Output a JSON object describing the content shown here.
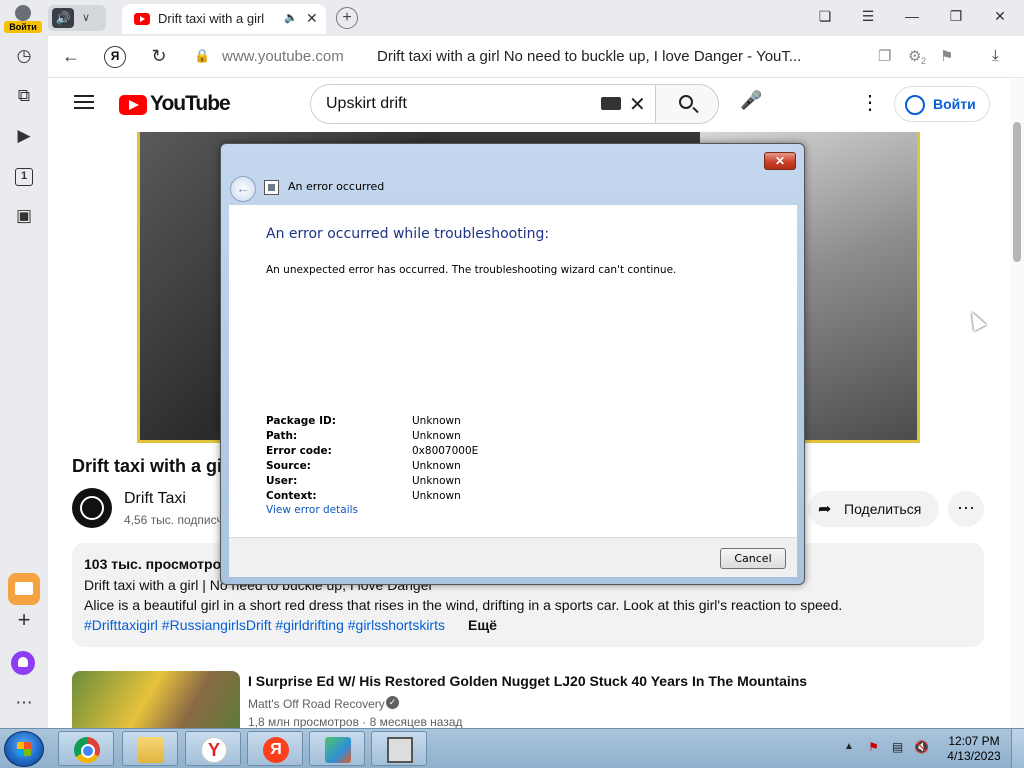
{
  "browser": {
    "login_label": "Войти",
    "tab_title": "Drift taxi with a girl N",
    "address_domain": "www.youtube.com",
    "address_title": "Drift taxi with a girl No need to buckle up, I love Danger - YouT...",
    "yandex_letter": "Я",
    "sidebar_counter": "1",
    "badge_count": "2"
  },
  "youtube": {
    "logo_text": "YouTube",
    "search_query": "Upskirt drift",
    "signin_label": "Войти",
    "video_title": "Drift taxi with a girl",
    "channel_name": "Drift Taxi",
    "subscribers": "4,56 тыс. подписчиков",
    "share_label": "Поделиться",
    "description": {
      "views": "103 тыс. просмотров",
      "line1": "Drift taxi with a girl | No need to buckle up, I love Danger",
      "line2": "Alice is a beautiful girl in a short red dress that rises in the wind, drifting in a sports car. Look at this girl's reaction to speed.",
      "tags": "#Drifttaxigirl #RussiangirlsDrift #girldrifting #girlsshortskirts",
      "more_label": "Ещё"
    },
    "recommendation": {
      "title": "I Surprise Ed W/ His Restored Golden Nugget LJ20 Stuck 40 Years In The Mountains",
      "channel": "Matt's Off Road Recovery",
      "meta": "1,8 млн просмотров · 8 месяцев назад"
    }
  },
  "dialog": {
    "window_title": "An error occurred",
    "main_instruction": "An error occurred while troubleshooting:",
    "message": "An unexpected error has occurred. The troubleshooting wizard can't continue.",
    "details": [
      {
        "key": "Package ID:",
        "value": "Unknown"
      },
      {
        "key": "Path:",
        "value": "Unknown"
      },
      {
        "key": "Error code:",
        "value": "0x8007000E"
      },
      {
        "key": "Source:",
        "value": "Unknown"
      },
      {
        "key": "User:",
        "value": "Unknown"
      },
      {
        "key": "Context:",
        "value": "Unknown"
      }
    ],
    "details_link": "View error details",
    "cancel_label": "Cancel"
  },
  "taskbar": {
    "time": "12:07 PM",
    "date": "4/13/2023",
    "apps": [
      "chrome",
      "file-explorer",
      "yandex-browser",
      "yandex",
      "cubes-app",
      "error-window"
    ]
  },
  "colors": {
    "youtube_red": "#ff0000",
    "link_blue": "#065fd4",
    "dialog_heading": "#1e3287",
    "login_badge": "#f6c000"
  }
}
